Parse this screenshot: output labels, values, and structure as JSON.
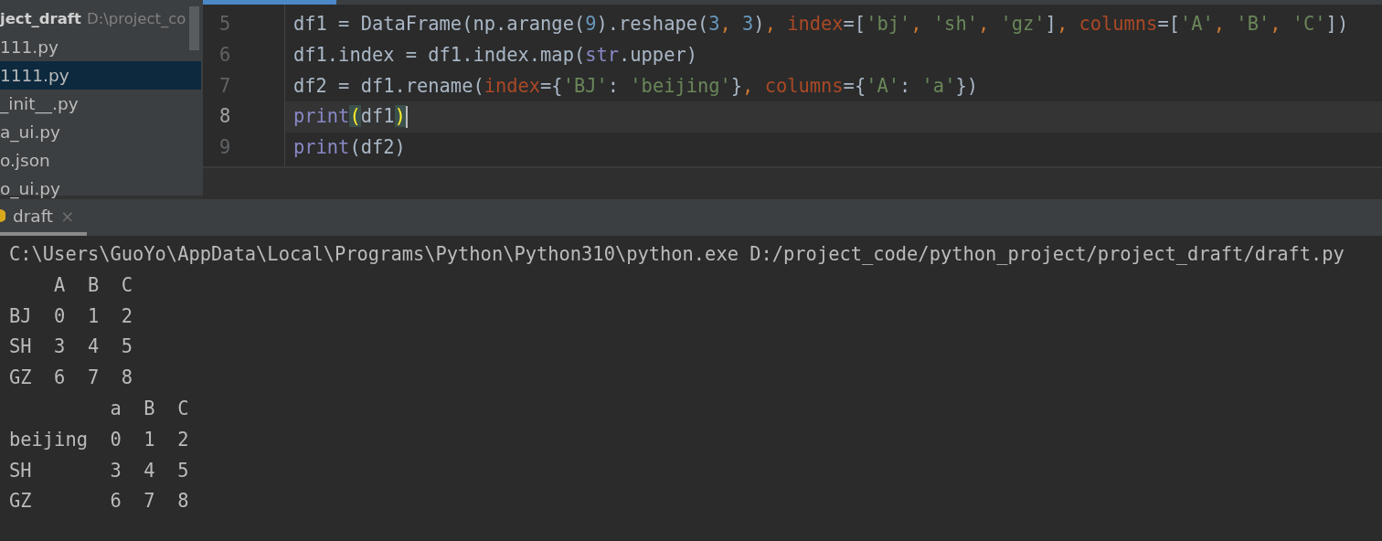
{
  "project_panel": {
    "header": {
      "name": "ject_draft",
      "path": "D:\\project_co"
    },
    "files": [
      {
        "name": "111.py",
        "selected": false
      },
      {
        "name": "1111.py",
        "selected": true
      },
      {
        "name": "_init__.py",
        "selected": false
      },
      {
        "name": "a_ui.py",
        "selected": false
      },
      {
        "name": "o.json",
        "selected": false
      },
      {
        "name": "o_ui.py",
        "selected": false
      }
    ]
  },
  "editor": {
    "lines": [
      {
        "number": "5",
        "caret": false,
        "tokens": [
          {
            "kind": "plain",
            "text": "df1 = DataFrame(np.arange("
          },
          {
            "kind": "number",
            "text": "9"
          },
          {
            "kind": "plain",
            "text": ").reshape("
          },
          {
            "kind": "number",
            "text": "3"
          },
          {
            "kind": "comma",
            "text": ", "
          },
          {
            "kind": "number",
            "text": "3"
          },
          {
            "kind": "plain",
            "text": ")"
          },
          {
            "kind": "comma",
            "text": ", "
          },
          {
            "kind": "param",
            "text": "index"
          },
          {
            "kind": "plain",
            "text": "=["
          },
          {
            "kind": "string",
            "text": "'bj'"
          },
          {
            "kind": "comma",
            "text": ", "
          },
          {
            "kind": "string",
            "text": "'sh'"
          },
          {
            "kind": "comma",
            "text": ", "
          },
          {
            "kind": "string",
            "text": "'gz'"
          },
          {
            "kind": "plain",
            "text": "]"
          },
          {
            "kind": "comma",
            "text": ", "
          },
          {
            "kind": "param",
            "text": "columns"
          },
          {
            "kind": "plain",
            "text": "=["
          },
          {
            "kind": "string",
            "text": "'A'"
          },
          {
            "kind": "comma",
            "text": ", "
          },
          {
            "kind": "string",
            "text": "'B'"
          },
          {
            "kind": "comma",
            "text": ", "
          },
          {
            "kind": "string",
            "text": "'C'"
          },
          {
            "kind": "plain",
            "text": "])"
          }
        ]
      },
      {
        "number": "6",
        "caret": false,
        "tokens": [
          {
            "kind": "plain",
            "text": "df1.index = df1.index.map("
          },
          {
            "kind": "builtin",
            "text": "str"
          },
          {
            "kind": "plain",
            "text": ".upper)"
          }
        ]
      },
      {
        "number": "7",
        "caret": false,
        "tokens": [
          {
            "kind": "plain",
            "text": "df2 = df1.rename("
          },
          {
            "kind": "param",
            "text": "index"
          },
          {
            "kind": "plain",
            "text": "={"
          },
          {
            "kind": "string",
            "text": "'BJ'"
          },
          {
            "kind": "plain",
            "text": ": "
          },
          {
            "kind": "string",
            "text": "'beijing'"
          },
          {
            "kind": "plain",
            "text": "}"
          },
          {
            "kind": "comma",
            "text": ", "
          },
          {
            "kind": "param",
            "text": "columns"
          },
          {
            "kind": "plain",
            "text": "={"
          },
          {
            "kind": "string",
            "text": "'A'"
          },
          {
            "kind": "plain",
            "text": ": "
          },
          {
            "kind": "string",
            "text": "'a'"
          },
          {
            "kind": "plain",
            "text": "})"
          }
        ]
      },
      {
        "number": "8",
        "caret": true,
        "tokens": [
          {
            "kind": "builtin",
            "text": "print"
          },
          {
            "kind": "brace",
            "text": "("
          },
          {
            "kind": "plain",
            "text": "df1"
          },
          {
            "kind": "brace",
            "text": ")"
          }
        ]
      },
      {
        "number": "9",
        "caret": false,
        "tokens": [
          {
            "kind": "builtin",
            "text": "print"
          },
          {
            "kind": "plain",
            "text": "(df2)"
          }
        ]
      }
    ]
  },
  "run_panel": {
    "tab": {
      "label": "draft",
      "selected": true,
      "close": "×"
    },
    "console_lines": [
      "C:\\Users\\GuoYo\\AppData\\Local\\Programs\\Python\\Python310\\python.exe D:/project_code/python_project/project_draft/draft.py",
      "    A  B  C",
      "BJ  0  1  2",
      "SH  3  4  5",
      "GZ  6  7  8",
      "         a  B  C",
      "beijing  0  1  2",
      "SH       3  4  5",
      "GZ       6  7  8"
    ]
  }
}
